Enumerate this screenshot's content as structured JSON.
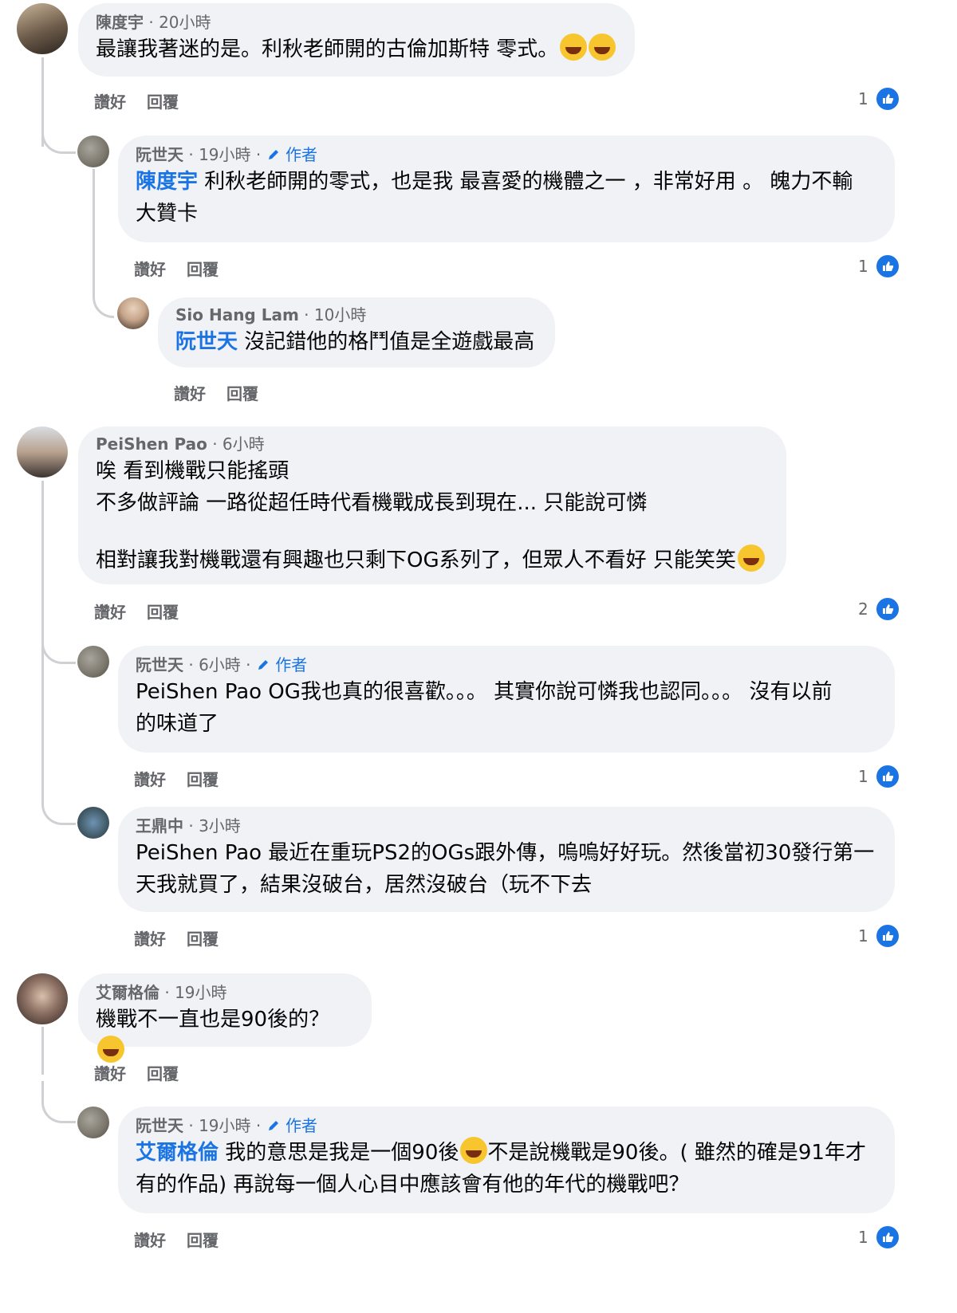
{
  "actions": {
    "like": "讚好",
    "reply": "回覆"
  },
  "author_badge": "作者",
  "comments": [
    {
      "name": "陳度宇",
      "time": "20小時",
      "text": "最讓我著迷的是。利秋老師開的古倫加斯特 零式。",
      "likes": "1"
    },
    {
      "name": "阮世天",
      "time": "19小時",
      "mention": "陳度宇",
      "text_line1": " 利秋老師開的零式，也是我 最喜愛的機體之一 ，非常好用 。 魄力不輸",
      "text_line2": "大贊卡",
      "likes": "1"
    },
    {
      "name": "Sio Hang Lam",
      "time": "10小時",
      "mention": "阮世天",
      "text": " 沒記錯他的格鬥值是全遊戲最高"
    },
    {
      "name": "PeiShen Pao",
      "time": "6小時",
      "line1": "唉 看到機戰只能搖頭",
      "line2": "不多做評論 一路從超任時代看機戰成長到現在... 只能說可憐",
      "line3": "相對讓我對機戰還有興趣也只剩下OG系列了，但眾人不看好 只能笑笑",
      "likes": "2"
    },
    {
      "name": "阮世天",
      "time": "6小時",
      "line1": "PeiShen Pao OG我也真的很喜歡。。。 其實你說可憐我也認同。。。 沒有以前",
      "line2": "的味道了",
      "likes": "1"
    },
    {
      "name": "王鼎中",
      "time": "3小時",
      "line1": "PeiShen Pao 最近在重玩PS2的OGs跟外傳，嗚嗚好好玩。然後當初30發行第一",
      "line2": "天我就買了，結果沒破台，居然沒破台（玩不下去",
      "likes": "1"
    },
    {
      "name": "艾爾格倫",
      "time": "19小時",
      "text": "機戰不一直也是90後的？"
    },
    {
      "name": "阮世天",
      "time": "19小時",
      "mention": "艾爾格倫",
      "text_a": " 我的意思是我是一個90後",
      "text_b": "不是說機戰是90後。( 雖然的確是91年才",
      "line2": "有的作品) 再說每一個人心目中應該會有他的年代的機戰吧？",
      "likes": "1"
    }
  ],
  "colors": {
    "accent": "#1b74e4",
    "bubble": "#f0f2f5",
    "meta": "#65676b"
  }
}
